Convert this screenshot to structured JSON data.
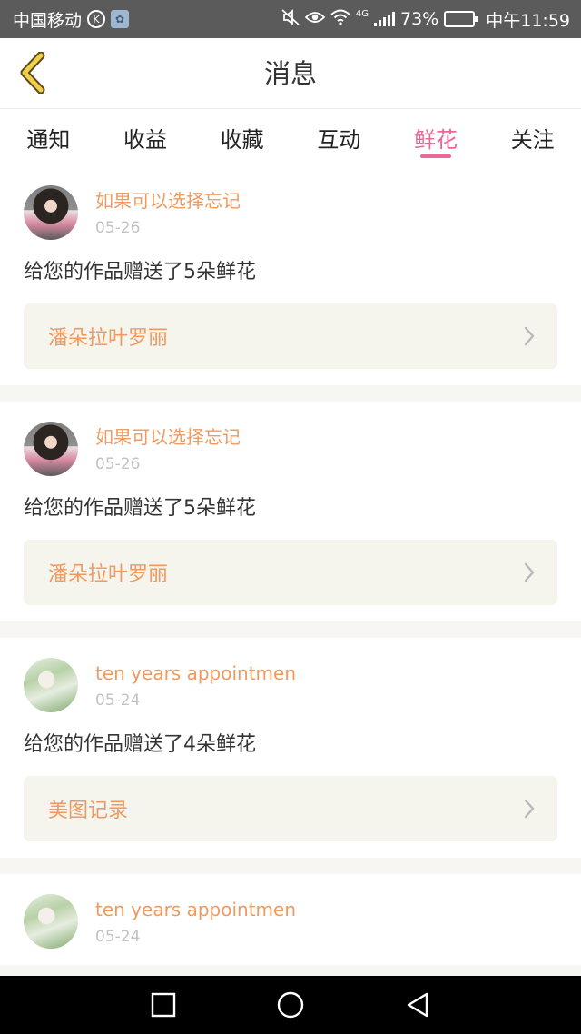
{
  "status_bar": {
    "carrier": "中国移动",
    "chip_label": "K",
    "network": "4G",
    "battery": "73%",
    "battery_level": 0.73,
    "time": "中午11:59"
  },
  "header": {
    "title": "消息",
    "back_icon": "chevron-left-icon"
  },
  "tabs": [
    {
      "label": "通知",
      "active": false
    },
    {
      "label": "收益",
      "active": false
    },
    {
      "label": "收藏",
      "active": false
    },
    {
      "label": "互动",
      "active": false
    },
    {
      "label": "鲜花",
      "active": true
    },
    {
      "label": "关注",
      "active": false
    }
  ],
  "colors": {
    "accent_pink": "#e8689a",
    "accent_orange": "#ef9a61",
    "status_bar": "#5b5b5b"
  },
  "messages": [
    {
      "user": "如果可以选择忘记",
      "date": "05-26",
      "text": "给您的作品赠送了5朵鲜花",
      "work": "潘朵拉叶罗丽",
      "avatar": "girl"
    },
    {
      "user": "如果可以选择忘记",
      "date": "05-26",
      "text": "给您的作品赠送了5朵鲜花",
      "work": "潘朵拉叶罗丽",
      "avatar": "girl"
    },
    {
      "user": "ten years appointmen",
      "date": "05-24",
      "text": "给您的作品赠送了4朵鲜花",
      "work": "美图记录",
      "avatar": "boy"
    },
    {
      "user": "ten years appointmen",
      "date": "05-24",
      "text": "",
      "work": "",
      "avatar": "boy"
    }
  ],
  "nav_bar": {
    "icons": [
      "recent-apps-icon",
      "home-icon",
      "back-triangle-icon"
    ]
  }
}
